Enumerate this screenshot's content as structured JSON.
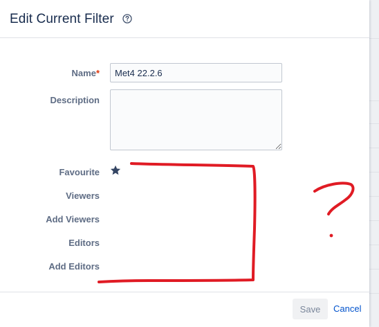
{
  "dialog": {
    "title": "Edit Current Filter",
    "help_icon": "question-circle-icon"
  },
  "form": {
    "name_label": "Name",
    "name_required_marker": "*",
    "name_value": "Met4 22.2.6",
    "description_label": "Description",
    "description_value": "",
    "favourite_label": "Favourite",
    "favourite_icon": "star-icon",
    "viewers_label": "Viewers",
    "add_viewers_label": "Add Viewers",
    "editors_label": "Editors",
    "add_editors_label": "Add Editors"
  },
  "footer": {
    "save_label": "Save",
    "cancel_label": "Cancel"
  },
  "annotation": {
    "text": "?",
    "color": "#e01b24"
  },
  "colors": {
    "title": "#172b4d",
    "label": "#5e6c84",
    "required": "#de350b",
    "link": "#0052cc",
    "star": "#344563"
  }
}
